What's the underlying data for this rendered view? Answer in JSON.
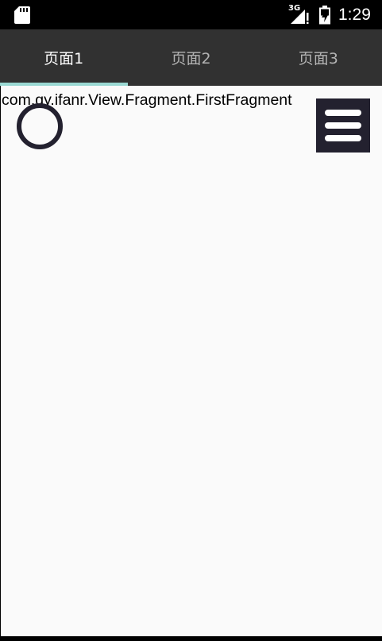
{
  "status_bar": {
    "network_label": "3G",
    "time": "1:29",
    "icons": [
      "sd-card-icon",
      "cellular-signal-icon",
      "battery-charging-icon"
    ]
  },
  "tabs": [
    {
      "label": "页面1",
      "active": true
    },
    {
      "label": "页面2",
      "active": false
    },
    {
      "label": "页面3",
      "active": false
    }
  ],
  "content": {
    "fragment_label": "com.gy.ifanr.View.Fragment.FirstFragment",
    "icons": [
      "circle-icon",
      "hamburger-menu-icon"
    ]
  },
  "colors": {
    "tab_bar_bg": "#313131",
    "tab_indicator": "#9ad9d3",
    "content_bg": "#fafafa",
    "icon_dark": "#23212f"
  }
}
